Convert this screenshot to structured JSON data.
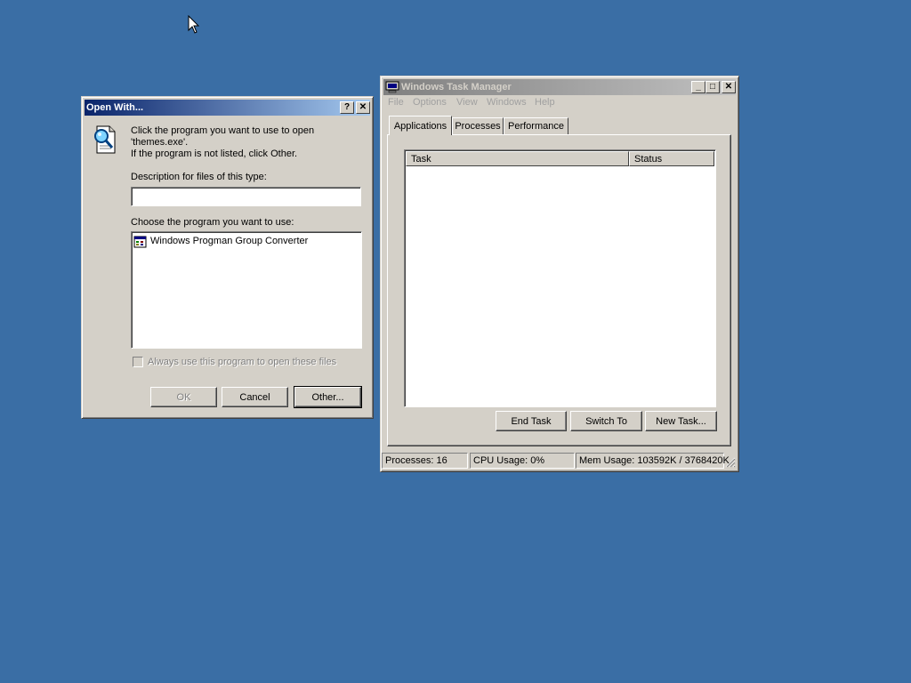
{
  "open_with": {
    "title": "Open With...",
    "help_btn": "?",
    "close_btn": "✕",
    "instruction_line1": "Click the program you want to use to open",
    "instruction_line2": "'themes.exe'.",
    "instruction_line3": "If the program is not listed, click Other.",
    "description_label": "Description for files of this type:",
    "description_value": "",
    "choose_label": "Choose the program you want to use:",
    "programs": [
      "Windows Progman Group Converter"
    ],
    "always_use_label": "Always use this program to open these files",
    "always_use_checked": false,
    "ok_label": "OK",
    "cancel_label": "Cancel",
    "other_label": "Other..."
  },
  "task_manager": {
    "title": "Windows Task Manager",
    "minimize_btn": "_",
    "maximize_btn": "□",
    "close_btn": "✕",
    "menu": [
      "File",
      "Options",
      "View",
      "Windows",
      "Help"
    ],
    "tabs": [
      "Applications",
      "Processes",
      "Performance"
    ],
    "selected_tab": "Applications",
    "columns": [
      "Task",
      "Status"
    ],
    "tasks": [],
    "end_task_label": "End Task",
    "switch_to_label": "Switch To",
    "new_task_label": "New Task...",
    "status": {
      "processes": "Processes: 16",
      "cpu": "CPU Usage: 0%",
      "mem": "Mem Usage: 103592K / 3768420K"
    }
  }
}
